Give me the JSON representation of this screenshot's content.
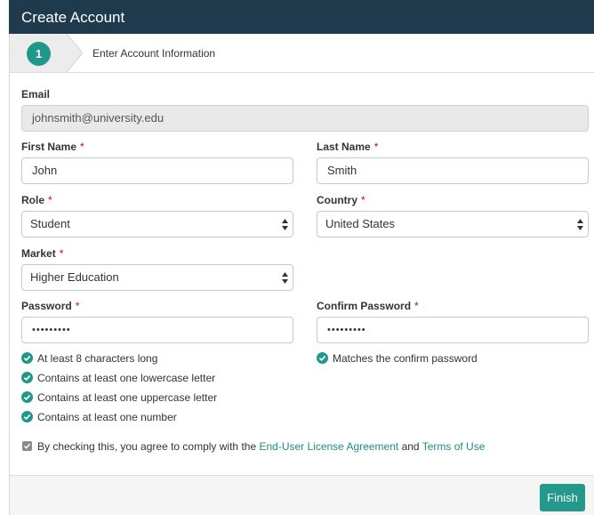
{
  "window": {
    "title": "Create Account"
  },
  "steps": [
    {
      "number": "1",
      "label": "Enter Account Information"
    }
  ],
  "form": {
    "email": {
      "label": "Email",
      "value": "johnsmith@university.edu"
    },
    "first_name": {
      "label": "First Name",
      "required": "*",
      "value": "John"
    },
    "last_name": {
      "label": "Last Name",
      "required": "*",
      "value": "Smith"
    },
    "role": {
      "label": "Role",
      "required": "*",
      "value": "Student"
    },
    "country": {
      "label": "Country",
      "required": "*",
      "value": "United States"
    },
    "market": {
      "label": "Market",
      "required": "*",
      "value": "Higher Education"
    },
    "password": {
      "label": "Password",
      "required": "*",
      "value": "•••••••••"
    },
    "confirm_password": {
      "label": "Confirm Password",
      "required": "*",
      "value": "•••••••••"
    }
  },
  "password_rules": [
    "At least 8 characters long",
    "Contains at least one lowercase letter",
    "Contains at least one uppercase letter",
    "Contains at least one number"
  ],
  "confirm_rule": "Matches the confirm password",
  "agreement": {
    "prefix": "By checking this, you agree to comply with the",
    "eula_link": "End-User License Agreement",
    "conjunction": "and",
    "terms_link": "Terms of Use",
    "checked": true
  },
  "buttons": {
    "finish": "Finish"
  },
  "colors": {
    "header": "#1f3a4d",
    "accent": "#21968a",
    "required": "#d0021b"
  }
}
